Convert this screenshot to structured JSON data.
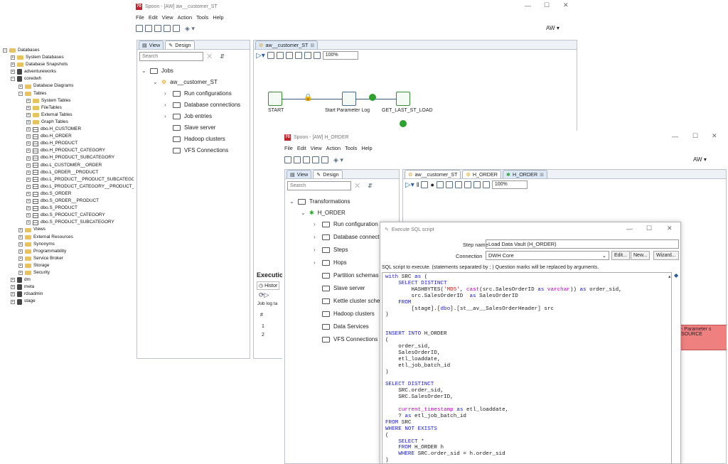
{
  "explorer": {
    "items": [
      {
        "label": "Databases",
        "tog": "⊟",
        "icon": "folder"
      },
      {
        "label": "System Databases",
        "tog": "⊞",
        "icon": "folder"
      },
      {
        "label": "Database Snapshots",
        "tog": "⊞",
        "icon": "folder"
      },
      {
        "label": "adventureworks",
        "tog": "⊞",
        "icon": "db"
      },
      {
        "label": "coredwh",
        "tog": "⊟",
        "icon": "db"
      },
      {
        "label": "Database Diagrams",
        "tog": "⊞",
        "icon": "folder"
      },
      {
        "label": "Tables",
        "tog": "⊟",
        "icon": "folder"
      },
      {
        "label": "System Tables",
        "tog": "⊞",
        "icon": "folder"
      },
      {
        "label": "FileTables",
        "tog": "⊞",
        "icon": "folder"
      },
      {
        "label": "External Tables",
        "tog": "⊞",
        "icon": "folder"
      },
      {
        "label": "Graph Tables",
        "tog": "⊞",
        "icon": "folder"
      },
      {
        "label": "dbo.H_CUSTOMER",
        "tog": "⊞",
        "icon": "table"
      },
      {
        "label": "dbo.H_ORDER",
        "tog": "⊞",
        "icon": "table"
      },
      {
        "label": "dbo.H_PRODUCT",
        "tog": "⊞",
        "icon": "table"
      },
      {
        "label": "dbo.H_PRODUCT_CATEGORY",
        "tog": "⊞",
        "icon": "table"
      },
      {
        "label": "dbo.H_PRODUCT_SUBCATEGORY",
        "tog": "⊞",
        "icon": "table"
      },
      {
        "label": "dbo.L_CUSTOMER__ORDER",
        "tog": "⊞",
        "icon": "table"
      },
      {
        "label": "dbo.L_ORDER__PRODUCT",
        "tog": "⊞",
        "icon": "table"
      },
      {
        "label": "dbo.L_PRODUCT__PRODUCT_SUBCATEGORY",
        "tog": "⊞",
        "icon": "table"
      },
      {
        "label": "dbo.L_PRODUCT_CATEGORY__PRODUCT_SUBCATEGORY",
        "tog": "⊞",
        "icon": "table"
      },
      {
        "label": "dbo.S_ORDER",
        "tog": "⊞",
        "icon": "table"
      },
      {
        "label": "dbo.S_ORDER__PRODUCT",
        "tog": "⊞",
        "icon": "table"
      },
      {
        "label": "dbo.S_PRODUCT",
        "tog": "⊞",
        "icon": "table"
      },
      {
        "label": "dbo.S_PRODUCT_CATEGORY",
        "tog": "⊞",
        "icon": "table"
      },
      {
        "label": "dbo.S_PRODUCT_SUBCATEGORY",
        "tog": "⊞",
        "icon": "table"
      },
      {
        "label": "Views",
        "tog": "⊞",
        "icon": "folder"
      },
      {
        "label": "External Resources",
        "tog": "⊞",
        "icon": "folder"
      },
      {
        "label": "Synonyms",
        "tog": "⊞",
        "icon": "folder"
      },
      {
        "label": "Programmability",
        "tog": "⊞",
        "icon": "folder"
      },
      {
        "label": "Service Broker",
        "tog": "⊞",
        "icon": "folder"
      },
      {
        "label": "Storage",
        "tog": "⊞",
        "icon": "folder"
      },
      {
        "label": "Security",
        "tog": "⊞",
        "icon": "folder"
      },
      {
        "label": "dm",
        "tog": "⊞",
        "icon": "db"
      },
      {
        "label": "meta",
        "tog": "⊞",
        "icon": "db"
      },
      {
        "label": "rdsadmin",
        "tog": "⊞",
        "icon": "db"
      },
      {
        "label": "stage",
        "tog": "⊞",
        "icon": "db"
      }
    ]
  },
  "spoon1": {
    "title": "Spoon - [AW] aw__customer_ST",
    "menu": [
      "File",
      "Edit",
      "View",
      "Action",
      "Tools",
      "Help"
    ],
    "user": "AW ▾",
    "tabs": {
      "view": "View",
      "design": "Design"
    },
    "search_placeholder": "Search",
    "tree": {
      "jobs": "Jobs",
      "job": "aw__customer_ST",
      "run": "Run configurations",
      "dbconn": "Database connections",
      "entries": "Job entries",
      "slave": "Slave server",
      "hadoop": "Hadoop clusters",
      "vfs": "VFS Connections"
    },
    "file_tab": "aw__customer_ST",
    "zoom": "100%",
    "steps": {
      "start": "START",
      "param": "Start Parameter Log",
      "last": "GET_LAST_ST_LOAD"
    },
    "exec_title": "Executio",
    "history": "Histor",
    "joblog": "Job log ta",
    "hash": "#",
    "row1": "1",
    "row2": "2"
  },
  "spoon2": {
    "title": "Spoon - [AW] H_ORDER",
    "menu": [
      "File",
      "Edit",
      "View",
      "Action",
      "Tools",
      "Help"
    ],
    "user": "AW ▾",
    "tabs": {
      "view": "View",
      "design": "Design"
    },
    "search_placeholder": "Search",
    "tree": {
      "trans": "Transformations",
      "name": "H_ORDER",
      "run": "Run configuration",
      "dbconn": "Database connecti",
      "steps": "Steps",
      "hops": "Hops",
      "part": "Partition schemas",
      "slave": "Slave server",
      "kettle": "Kettle cluster scher",
      "hadoop": "Hadoop clusters",
      "data": "Data Services",
      "vfs": "VFS Connections"
    },
    "file_tabs": [
      "aw__customer_ST",
      "H_ORDER",
      "H_ORDER"
    ],
    "zoom": "100%",
    "error_text": "- Parameter s",
    "error_text2": "SOURCE"
  },
  "dialog": {
    "title": "Execute SQL script",
    "step_name_label": "Step name",
    "step_name": "Load Data Vault (H_ORDER)",
    "conn_label": "Connection",
    "conn": "DWH Core",
    "edit": "Edit...",
    "new": "New...",
    "wizard": "Wizard...",
    "hint": "SQL script to execute. (statements separated by ; ) Question marks will be replaced by arguments."
  }
}
